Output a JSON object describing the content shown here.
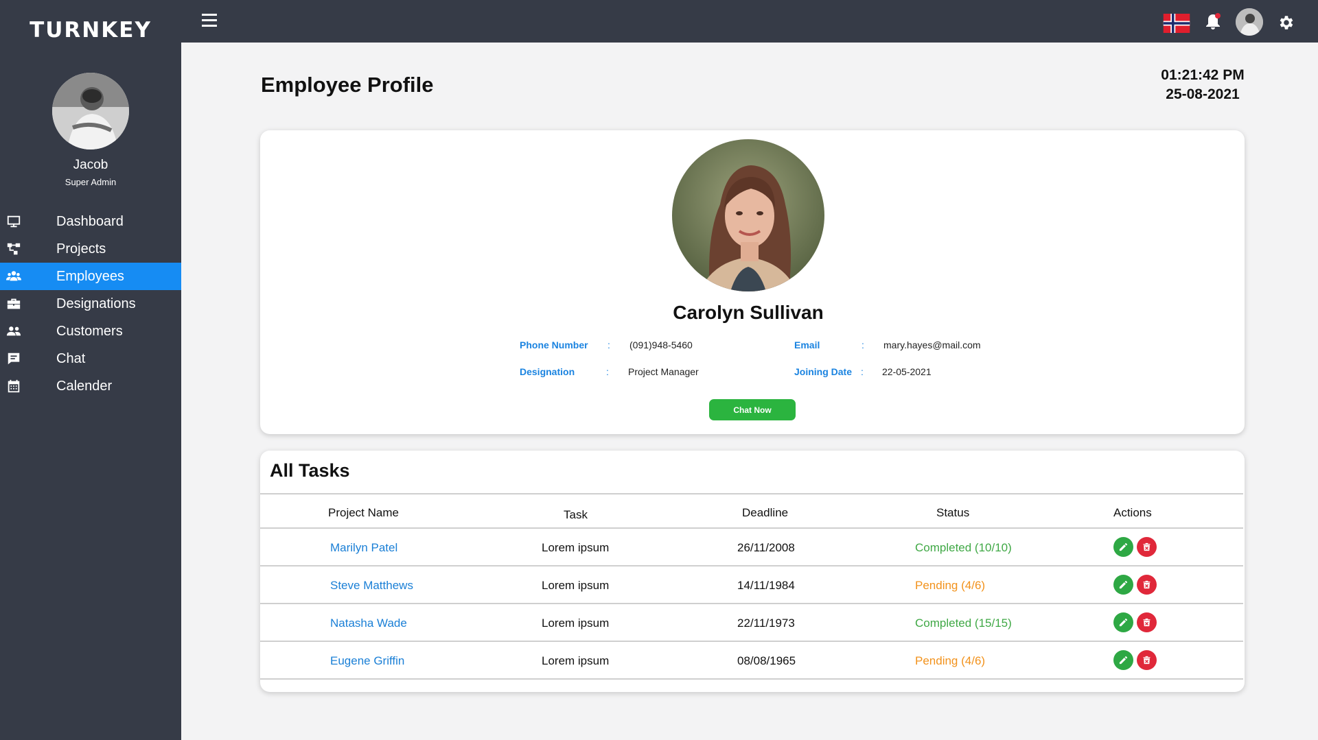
{
  "app": {
    "logo": "TURNKEY"
  },
  "sidebar": {
    "user": {
      "name": "Jacob",
      "role": "Super Admin"
    },
    "items": [
      {
        "label": "Dashboard",
        "icon": "monitor-icon",
        "active": false
      },
      {
        "label": "Projects",
        "icon": "project-diagram-icon",
        "active": false
      },
      {
        "label": "Employees",
        "icon": "users-icon",
        "active": true
      },
      {
        "label": "Designations",
        "icon": "briefcase-icon",
        "active": false
      },
      {
        "label": "Customers",
        "icon": "user-group-icon",
        "active": false
      },
      {
        "label": "Chat",
        "icon": "chat-icon",
        "active": false
      },
      {
        "label": "Calender",
        "icon": "calendar-icon",
        "active": false
      }
    ]
  },
  "topbar": {
    "icons": [
      "menu-icon",
      "norway-flag-icon",
      "bell-icon",
      "avatar",
      "gear-icon"
    ]
  },
  "header": {
    "title": "Employee Profile",
    "time": "01:21:42 PM",
    "date": "25-08-2021"
  },
  "profile": {
    "name": "Carolyn Sullivan",
    "phone_label": "Phone Number",
    "phone": "(091)948-5460",
    "email_label": "Email",
    "email": "mary.hayes@mail.com",
    "designation_label": "Designation",
    "designation": "Project Manager",
    "joining_label": "Joining Date",
    "joining_date": "22-05-2021",
    "colon": ":",
    "chat_button": "Chat Now"
  },
  "tasks": {
    "title": "All Tasks",
    "columns": [
      "Project Name",
      "Task",
      "Deadline",
      "Status",
      "Actions"
    ],
    "rows": [
      {
        "project": "Marilyn Patel",
        "task": "Lorem ipsum",
        "deadline": "26/11/2008",
        "status": "Completed (10/10)",
        "state": "completed"
      },
      {
        "project": "Steve Matthews",
        "task": "Lorem ipsum",
        "deadline": "14/11/1984",
        "status": "Pending (4/6)",
        "state": "pending"
      },
      {
        "project": "Natasha Wade",
        "task": "Lorem ipsum",
        "deadline": "22/11/1973",
        "status": "Completed (15/15)",
        "state": "completed"
      },
      {
        "project": "Eugene Griffin",
        "task": "Lorem ipsum",
        "deadline": "08/08/1965",
        "status": "Pending (4/6)",
        "state": "pending"
      }
    ]
  },
  "colors": {
    "sidebar": "#363b47",
    "accent": "#168cf3",
    "success": "#2bb43f",
    "completed": "#3fa845",
    "pending": "#f2921c",
    "danger": "#e0283a"
  }
}
